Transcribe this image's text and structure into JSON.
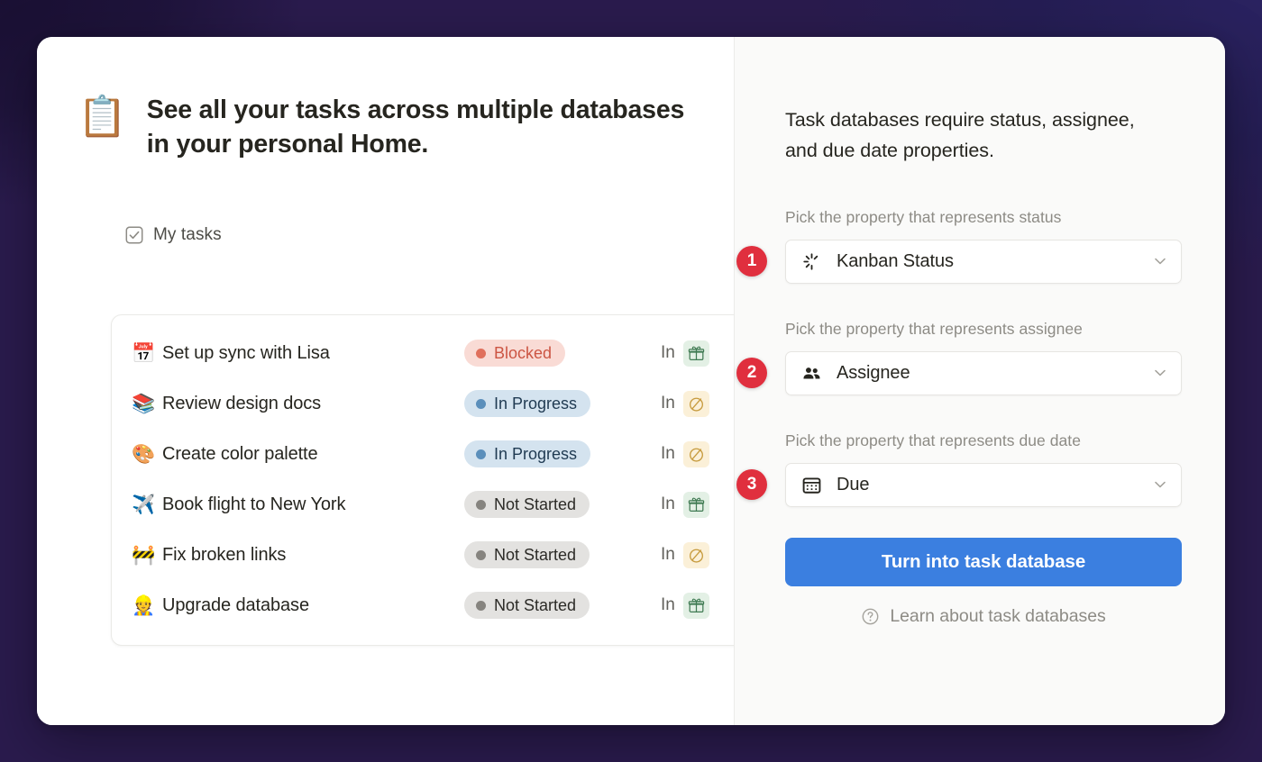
{
  "backdrop": {
    "colors": {
      "top_left": "#1a1033",
      "top_center_pink": "#dd8ed4",
      "top_right": "#2a2260",
      "bottom_left_purple": "#5a3080",
      "bottom_right_navy": "#1e2a5e"
    }
  },
  "left_pane": {
    "headline_emoji": "📋",
    "headline_emoji_name": "clipboard-emoji",
    "headline": "See all your tasks across multiple databases in your personal Home.",
    "my_tasks_label": "My tasks",
    "checkbox_icon": "checkbox-checked-icon",
    "columns": {
      "in_column_label": "In"
    },
    "tasks": [
      {
        "emoji": "📅",
        "emoji_name": "calendar-emoji",
        "title": "Set up sync with Lisa",
        "status": "Blocked",
        "status_color": "#cc5543",
        "status_bg": "#f9dbd5",
        "status_dot": "#e0705c",
        "in_label": "In",
        "in_icon": "gift-icon",
        "in_icon_color": "#3f7a52",
        "in_icon_bg": "#e3f0e5"
      },
      {
        "emoji": "📚",
        "emoji_name": "books-emoji",
        "title": "Review design docs",
        "status": "In Progress",
        "status_color": "#1f3a52",
        "status_bg": "#d4e3ef",
        "status_dot": "#5b8fbb",
        "in_label": "In",
        "in_icon": "circle-slash-icon",
        "in_icon_color": "#c79b3e",
        "in_icon_bg": "#fbf0d8"
      },
      {
        "emoji": "🎨",
        "emoji_name": "artist-palette-emoji",
        "title": "Create color palette",
        "status": "In Progress",
        "status_color": "#1f3a52",
        "status_bg": "#d4e3ef",
        "status_dot": "#5b8fbb",
        "in_label": "In",
        "in_icon": "circle-slash-icon",
        "in_icon_color": "#c79b3e",
        "in_icon_bg": "#fbf0d8"
      },
      {
        "emoji": "✈️",
        "emoji_name": "airplane-emoji",
        "title": "Book flight to New York",
        "status": "Not Started",
        "status_color": "#2c2b27",
        "status_bg": "#e3e2e0",
        "status_dot": "#86847f",
        "in_label": "In",
        "in_icon": "gift-icon",
        "in_icon_color": "#3f7a52",
        "in_icon_bg": "#e3f0e5"
      },
      {
        "emoji": "🚧",
        "emoji_name": "construction-emoji",
        "title": "Fix broken links",
        "status": "Not Started",
        "status_color": "#2c2b27",
        "status_bg": "#e3e2e0",
        "status_dot": "#86847f",
        "in_label": "In",
        "in_icon": "circle-slash-icon",
        "in_icon_color": "#c79b3e",
        "in_icon_bg": "#fbf0d8"
      },
      {
        "emoji": "👷",
        "emoji_name": "construction-worker-emoji",
        "title": "Upgrade database",
        "status": "Not Started",
        "status_color": "#2c2b27",
        "status_bg": "#e3e2e0",
        "status_dot": "#86847f",
        "in_label": "In",
        "in_icon": "gift-icon",
        "in_icon_color": "#3f7a52",
        "in_icon_bg": "#e3f0e5"
      }
    ]
  },
  "right_pane": {
    "intro": "Task databases require status, assignee, and due date properties.",
    "fields": [
      {
        "step": "1",
        "label": "Pick the property that represents status",
        "value": "Kanban Status",
        "icon": "spinner-status-icon"
      },
      {
        "step": "2",
        "label": "Pick the property that represents assignee",
        "value": "Assignee",
        "icon": "people-icon"
      },
      {
        "step": "3",
        "label": "Pick the property that represents due date",
        "value": "Due",
        "icon": "calendar-icon"
      }
    ],
    "cta_label": "Turn into task database",
    "cta_color": "#3b7fe0",
    "learn_label": "Learn about task databases",
    "learn_icon": "question-circle-icon",
    "step_badge_color": "#e02f3e"
  }
}
